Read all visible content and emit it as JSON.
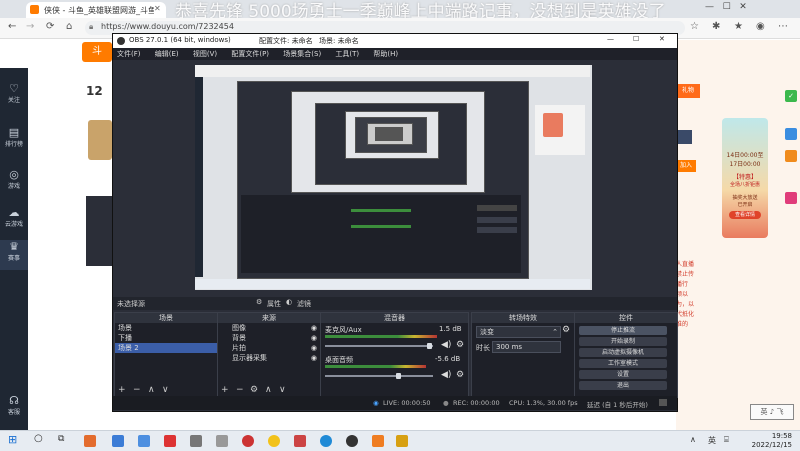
{
  "browser": {
    "tab_title": "侠侠 - 斗鱼_英雄联盟网游_斗鱼直播",
    "url": "https://www.douyu.com/7232454",
    "marquee": "恭喜先锋 5000场勇士一季巅峰上中端路记事，没想到是英雄没了"
  },
  "sidebar": {
    "items": [
      {
        "label": "关注",
        "icon": "heart-icon"
      },
      {
        "label": "排行榜",
        "icon": "rank-icon"
      },
      {
        "label": "游戏",
        "icon": "gamepad-icon"
      },
      {
        "label": "云游戏",
        "icon": "cloud-game-icon"
      },
      {
        "label": "赛事",
        "icon": "trophy-icon"
      },
      {
        "label": "客服",
        "icon": "headset-icon"
      }
    ]
  },
  "right_ad": {
    "time_line1": "14日00:00至",
    "time_line2": "17日00:00",
    "tag": "【特惠】",
    "line3": "全场八折钜惠",
    "line4": "抽奖大放送",
    "line5": "已开启",
    "button": "查看详情",
    "side_text": [
      "人直播",
      "禁止传",
      "播行",
      "频以",
      "为，以",
      "代抵化",
      "谁的"
    ]
  },
  "obs": {
    "title": "OBS 27.0.1 (64 bit, windows)",
    "profile": "配置文件: 未命名",
    "scene_collection": "场景: 未命名",
    "menu": [
      "文件(F)",
      "编辑(E)",
      "视图(V)",
      "配置文件(P)",
      "场景集合(S)",
      "工具(T)",
      "帮助(H)"
    ],
    "source_bar": {
      "label": "未选择源",
      "props": "属性",
      "filters": "滤镜"
    },
    "docks": {
      "scenes": {
        "title": "场景",
        "items": [
          "场景",
          "下播",
          "场景 2"
        ]
      },
      "sources": {
        "title": "来源",
        "items": [
          "图像",
          "背景",
          "片拍",
          "显示器采集"
        ]
      },
      "mixer": {
        "title": "混音器",
        "channels": [
          {
            "name": "麦克风/Aux",
            "db": "1.5 dB",
            "level": 0.8
          },
          {
            "name": "桌面音频",
            "db": "-5.6 dB",
            "level": 0.72
          }
        ]
      },
      "transitions": {
        "title": "转场特效",
        "type": "淡变",
        "duration_label": "时长",
        "duration": "300 ms"
      },
      "controls": {
        "title": "控件",
        "buttons": [
          "停止推流",
          "开始录制",
          "启动虚拟摄像机",
          "工作室模式",
          "设置",
          "退出"
        ]
      }
    },
    "status": {
      "live": "LIVE: 00:00:50",
      "rec": "REC: 00:00:00",
      "cpu": "CPU: 1.3%, 30.00 fps",
      "delay": "延迟 (自 1 秒后开始)"
    }
  },
  "taskbar": {
    "time": "19:58",
    "date": "2022/12/15",
    "lang": "英",
    "watermark": "英 ♪ 飞"
  },
  "colors": {
    "obs_bg": "#2b2e38",
    "dock_bg": "#1e2028",
    "accent": "#3b5ea8",
    "sidebar": "#1f2733",
    "taskbar": "#e7ecf2"
  }
}
